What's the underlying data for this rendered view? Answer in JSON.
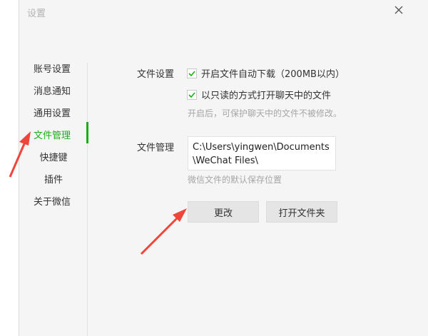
{
  "window": {
    "title": "设置"
  },
  "sidebar": {
    "items": [
      {
        "label": "账号设置"
      },
      {
        "label": "消息通知"
      },
      {
        "label": "通用设置"
      },
      {
        "label": "文件管理"
      },
      {
        "label": "快捷键"
      },
      {
        "label": "插件"
      },
      {
        "label": "关于微信"
      }
    ]
  },
  "file_settings": {
    "label": "文件设置",
    "auto_download_label": "开启文件自动下载（200MB以内）",
    "readonly_open_label": "以只读的方式打开聊天中的文件",
    "readonly_hint": "开启后，可保护聊天中的文件不被修改。"
  },
  "file_management": {
    "label": "文件管理",
    "path": "C:\\Users\\yingwen\\Documents\\WeChat Files\\",
    "hint": "微信文件的默认保存位置",
    "change_button": "更改",
    "open_folder_button": "打开文件夹"
  },
  "colors": {
    "accent": "#1aad19",
    "annotation": "#f0453a"
  }
}
